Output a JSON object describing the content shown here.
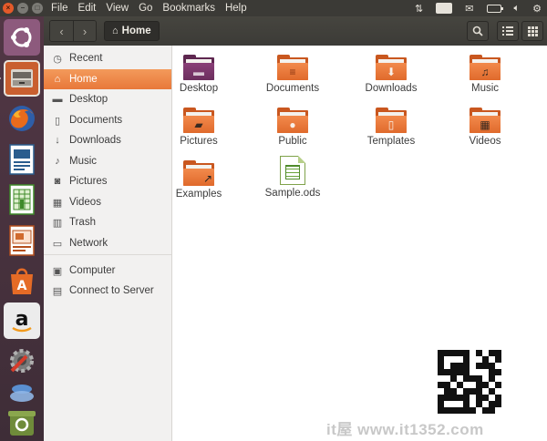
{
  "menubar": {
    "items": [
      "File",
      "Edit",
      "View",
      "Go",
      "Bookmarks",
      "Help"
    ],
    "keyboard_layout": "En",
    "tray_icons": [
      "network-updown-icon",
      "keyboard-layout-icon",
      "mail-icon",
      "battery-icon",
      "volume-icon",
      "power-gear-icon"
    ]
  },
  "launcher": {
    "items": [
      "ubuntu-dash-icon",
      "files-icon",
      "firefox-icon",
      "writer-icon",
      "calc-icon",
      "impress-icon",
      "software-center-icon",
      "amazon-icon",
      "system-settings-icon",
      "workspace-switcher-icon",
      "trash-icon"
    ]
  },
  "toolbar": {
    "back_icon": "‹",
    "forward_icon": "›",
    "breadcrumb": "Home"
  },
  "sidebar": {
    "items": [
      {
        "label": "Recent",
        "icon": "clock-icon"
      },
      {
        "label": "Home",
        "icon": "home-icon",
        "active": true
      },
      {
        "label": "Desktop",
        "icon": "folder-icon"
      },
      {
        "label": "Documents",
        "icon": "document-icon"
      },
      {
        "label": "Downloads",
        "icon": "download-icon"
      },
      {
        "label": "Music",
        "icon": "music-note-icon"
      },
      {
        "label": "Pictures",
        "icon": "camera-icon"
      },
      {
        "label": "Videos",
        "icon": "film-icon"
      },
      {
        "label": "Trash",
        "icon": "trash-icon"
      },
      {
        "label": "Network",
        "icon": "network-icon"
      },
      {
        "label": "Computer",
        "icon": "drive-icon"
      },
      {
        "label": "Connect to Server",
        "icon": "server-icon"
      }
    ]
  },
  "files": [
    {
      "label": "Desktop",
      "kind": "folder-desktop"
    },
    {
      "label": "Documents",
      "kind": "folder"
    },
    {
      "label": "Downloads",
      "kind": "folder-download"
    },
    {
      "label": "Music",
      "kind": "folder-music"
    },
    {
      "label": "Pictures",
      "kind": "folder-pictures"
    },
    {
      "label": "Public",
      "kind": "folder-public"
    },
    {
      "label": "Templates",
      "kind": "folder-templates"
    },
    {
      "label": "Videos",
      "kind": "folder-videos"
    },
    {
      "label": "Examples",
      "kind": "folder-link"
    },
    {
      "label": "Sample.ods",
      "kind": "spreadsheet"
    }
  ],
  "watermark": "it屋 www.it1352.com",
  "colors": {
    "accent": "#e8783a",
    "panel": "#3b3a36",
    "launcher": "#4a3340",
    "folder": "#e06a2c"
  }
}
